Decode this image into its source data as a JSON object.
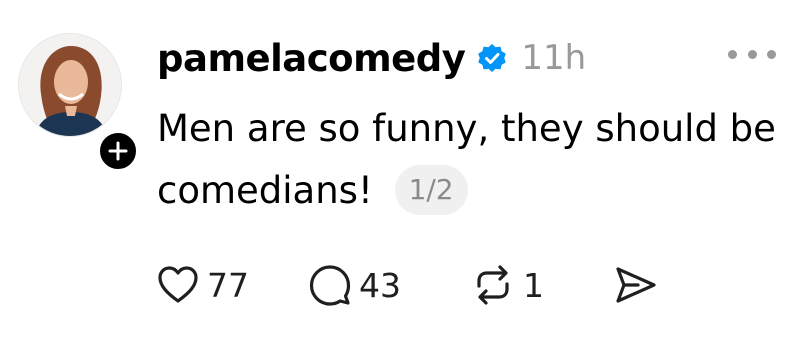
{
  "post": {
    "author": {
      "username": "pamelacomedy",
      "verified": true
    },
    "timestamp": "11h",
    "text": "Men are so funny, they should be comedians!",
    "page_indicator": "1/2",
    "actions": {
      "likes": "77",
      "comments": "43",
      "reposts": "1"
    }
  },
  "icons": {
    "follow": "plus-icon",
    "verified": "verified-badge-icon",
    "more": "more-dots-icon",
    "like": "heart-icon",
    "comment": "comment-bubble-icon",
    "repost": "repost-icon",
    "share": "send-icon"
  },
  "colors": {
    "text": "#000000",
    "muted": "#999999",
    "verified": "#0095F6",
    "pill_bg": "#F0F0F0"
  }
}
